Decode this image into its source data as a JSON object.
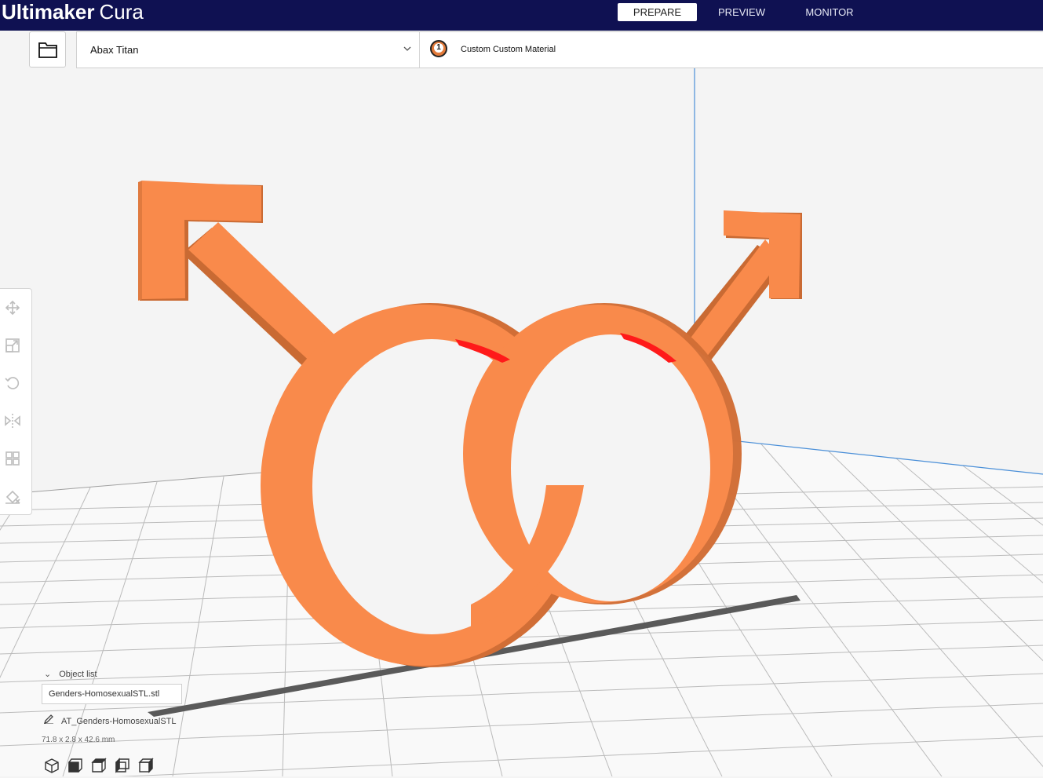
{
  "app": {
    "logo_bold": "Ultimaker",
    "logo_light": "Cura"
  },
  "stages": [
    {
      "label": "PREPARE",
      "active": true
    },
    {
      "label": "PREVIEW",
      "active": false
    },
    {
      "label": "MONITOR",
      "active": false
    }
  ],
  "printer": {
    "name": "Abax Titan"
  },
  "extruder": {
    "number": "1",
    "material": "Custom Custom Material",
    "color": "#e27a3a"
  },
  "toolbar": {
    "tools": [
      "move-icon",
      "scale-icon",
      "rotate-icon",
      "mirror-icon",
      "per-model-settings-icon",
      "support-blocker-icon"
    ]
  },
  "object_list": {
    "header": "Object list",
    "items": [
      "Genders-HomosexualSTL.stl"
    ]
  },
  "job": {
    "name": "AT_Genders-HomosexualSTL",
    "dimensions": "71.8 x 2.8 x 42.6 mm"
  },
  "view_orientation": {
    "buttons": [
      "view-3d-icon",
      "view-front-icon",
      "view-top-icon",
      "view-left-icon",
      "view-right-icon"
    ]
  },
  "colors": {
    "header_bg": "#0f1152",
    "model": "#f98a4b",
    "model_shade": "#d86a30",
    "overhang": "#ff1a1a",
    "build_plate": "#f7f7f7",
    "grid": "#b8b8b8"
  }
}
